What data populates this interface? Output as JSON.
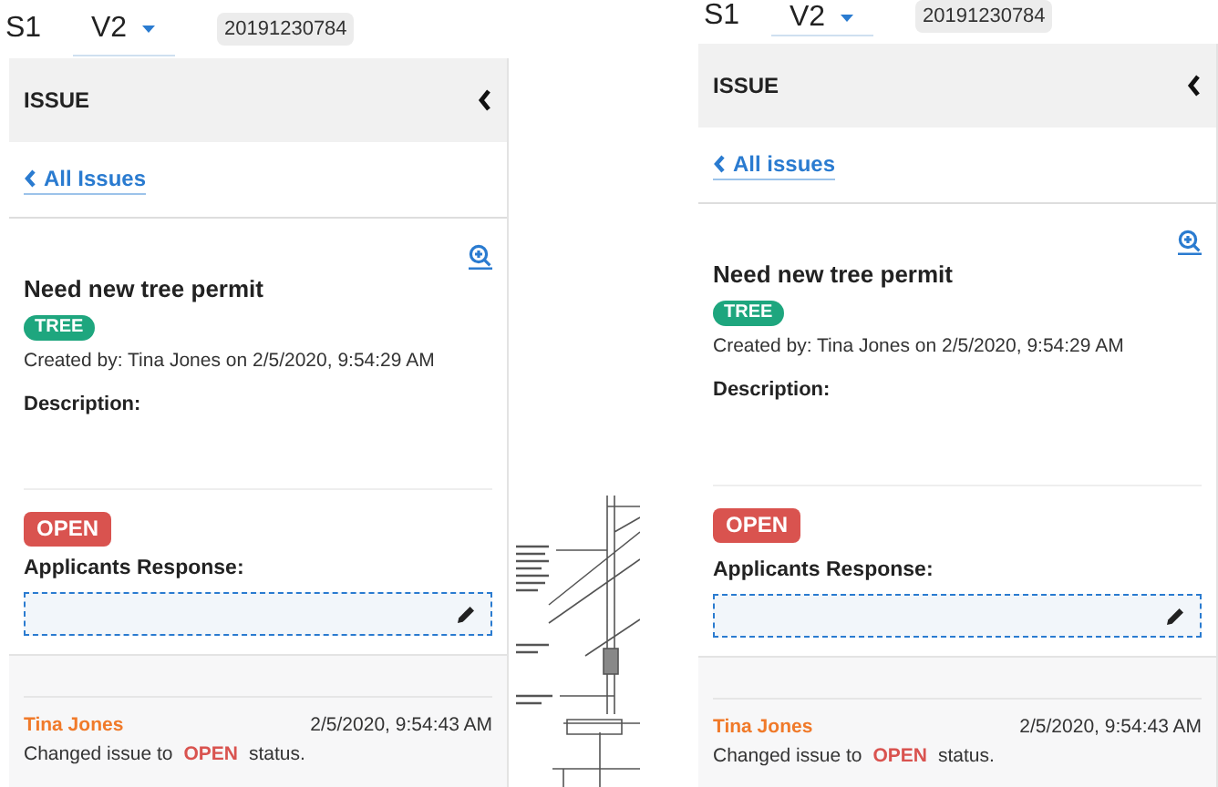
{
  "panels": [
    {
      "sheet": "S1",
      "version": "V2",
      "number": "20191230784",
      "header": "ISSUE",
      "back_link": "All Issues",
      "title": "Need new tree permit",
      "tag": "TREE",
      "created": "Created by: Tina Jones on 2/5/2020, 9:54:29 AM",
      "description_label": "Description:",
      "status": "OPEN",
      "response_label": "Applicants Response:",
      "activity": [
        {
          "author": "Tina Jones",
          "time": "2/5/2020, 9:54:43 AM",
          "before": "Changed issue to",
          "status": "OPEN",
          "after": "status."
        }
      ]
    },
    {
      "sheet": "S1",
      "version": "V2",
      "number": "20191230784",
      "header": "ISSUE",
      "back_link": "All issues",
      "title": "Need new tree permit",
      "tag": "TREE",
      "created": "Created by: Tina Jones on 2/5/2020, 9:54:29 AM",
      "description_label": "Description:",
      "status": "OPEN",
      "response_label": "Applicants Response:",
      "activity": [
        {
          "author": "Tina Jones",
          "time": "2/5/2020, 9:54:43 AM",
          "before": "Changed issue to",
          "status": "OPEN",
          "after": "status."
        }
      ]
    }
  ]
}
